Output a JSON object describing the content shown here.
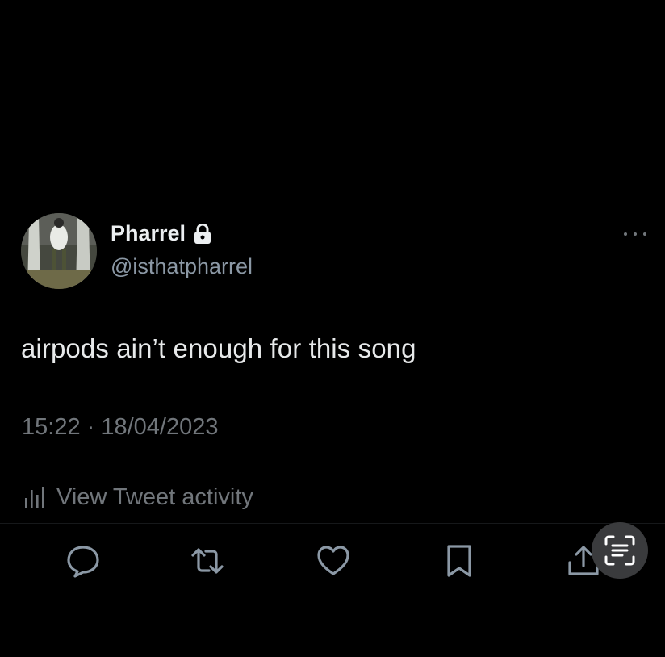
{
  "tweet": {
    "author": {
      "display_name": "Pharrel",
      "handle": "@isthatpharrel",
      "protected_icon": "lock-icon",
      "avatar": "avatar-photo"
    },
    "text": "airpods ain’t enough for this song",
    "timestamp": "15:22 · 18/04/2023",
    "activity_label": "View Tweet activity"
  },
  "actions": {
    "reply": "reply-icon",
    "retweet": "retweet-icon",
    "like": "like-icon",
    "bookmark": "bookmark-icon",
    "share": "share-icon"
  },
  "overlay": {
    "scan_button": "text-scan-icon"
  },
  "colors": {
    "background": "#000000",
    "primary_text": "#e7e9ea",
    "secondary_text": "#71767b",
    "icon": "#8b98a5",
    "scan_button_bg": "#3a3b3d"
  }
}
